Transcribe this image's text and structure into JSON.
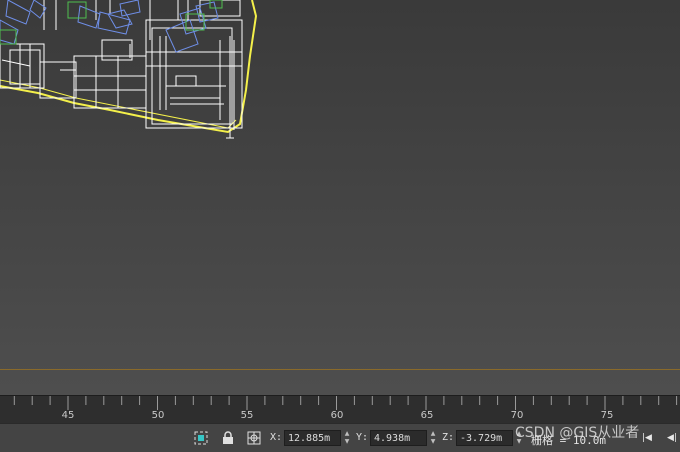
{
  "timeline": {
    "ticks": [
      "45",
      "50",
      "55",
      "60",
      "65",
      "70",
      "75"
    ]
  },
  "status": {
    "x_label": "X:",
    "x_value": "12.885m",
    "y_label": "Y:",
    "y_value": "4.938m",
    "z_label": "Z:",
    "z_value": "-3.729m",
    "grid_text": "栅格 = 10.0m"
  },
  "watermark": "CSDN @GIS从业者",
  "icons": {
    "selection_toggle": "selection-lock-toggle-icon",
    "lock": "lock-icon",
    "absolute_mode": "absolute-mode-icon",
    "prev_frame": "go-to-start-icon",
    "play_back": "previous-frame-icon"
  },
  "colors": {
    "selection_box": "#f4f04a",
    "wireframe": "#ffffff",
    "furniture_blue": "#6f8fe8",
    "furniture_green": "#4fbf4f",
    "horizon": "#8a6a2a"
  }
}
